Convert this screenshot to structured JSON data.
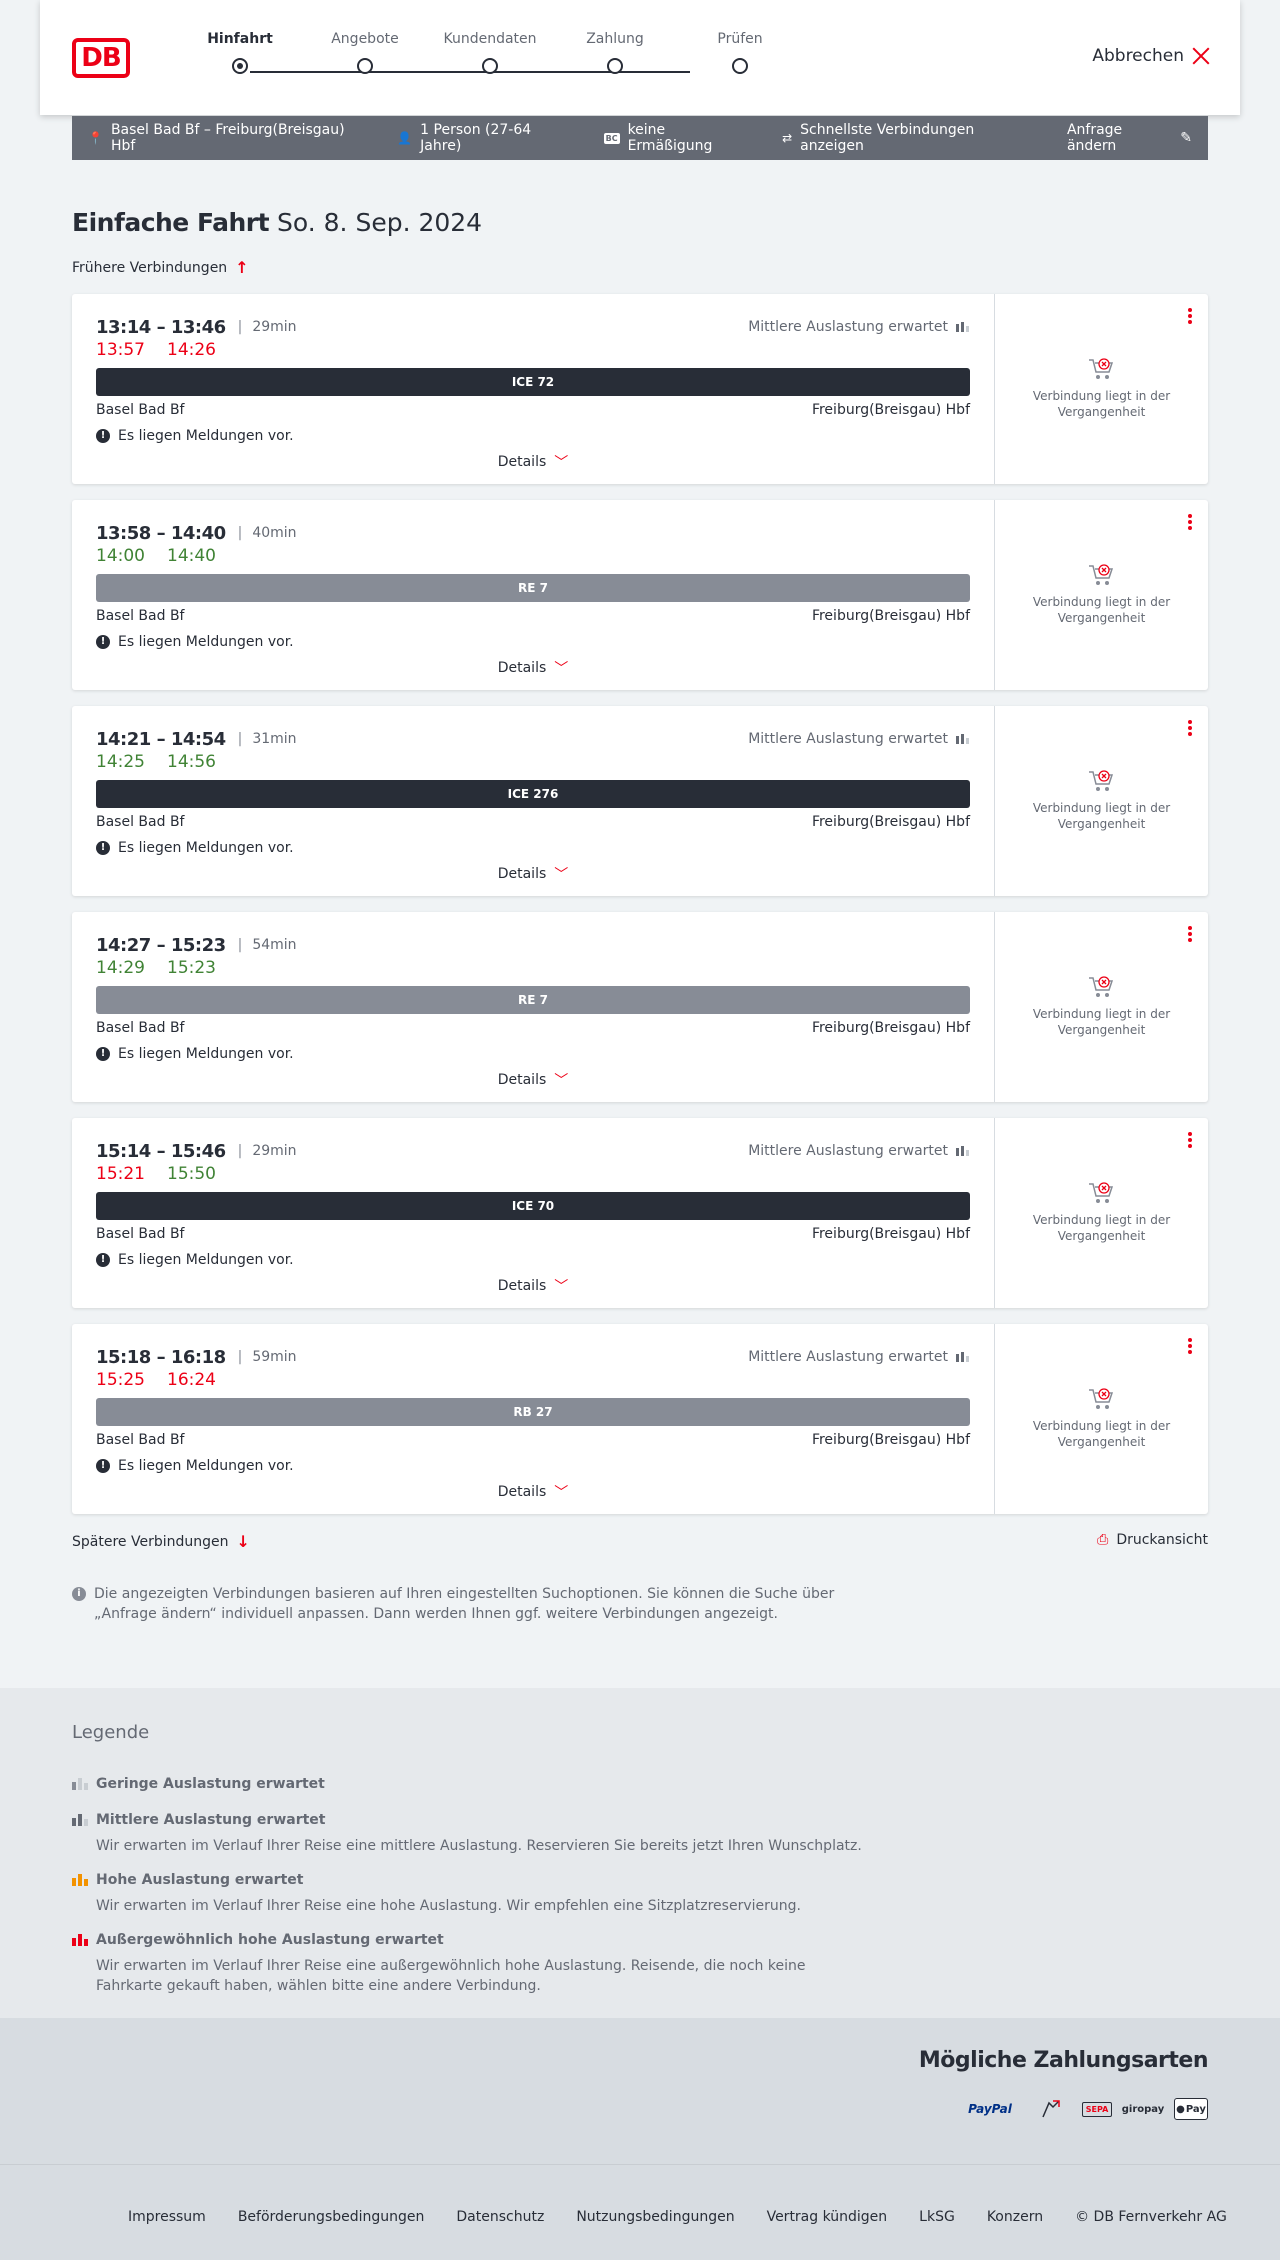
{
  "header": {
    "logo": "DB",
    "cancel_label": "Abbrechen",
    "steps": [
      {
        "label": "Hinfahrt"
      },
      {
        "label": "Angebote"
      },
      {
        "label": "Kundendaten"
      },
      {
        "label": "Zahlung"
      },
      {
        "label": "Prüfen"
      }
    ],
    "active_step": 0
  },
  "request": {
    "route": "Basel Bad Bf – Freiburg(Breisgau) Hbf",
    "passengers": "1 Person (27-64 Jahre)",
    "bc_badge": "BC",
    "discount": "keine Ermäßigung",
    "fastest": "Schnellste Verbindungen anzeigen",
    "edit_label": "Anfrage ändern"
  },
  "page": {
    "title": "Einfache Fahrt",
    "date": "So. 8. Sep. 2024",
    "earlier_label": "Frühere Verbindungen",
    "later_label": "Spätere Verbindungen",
    "print_label": "Druckansicht",
    "note": "Die angezeigten Verbindungen basieren auf Ihren eingestellten Suchoptionen. Sie können die Suche über „Anfrage ändern“ individuell anpassen. Dann werden Ihnen ggf. weitere Verbindungen angezeigt."
  },
  "connections": [
    {
      "plan": "13:14 – 13:46",
      "duration": "29min",
      "occupancy": "Mittlere Auslastung erwartet",
      "rt_dep": "13:57",
      "rt_arr": "14:26",
      "dep_status": "delay",
      "arr_status": "delay",
      "train": "ICE 72",
      "train_type": "ice",
      "from": "Basel Bad Bf",
      "to": "Freiburg(Breisgau) Hbf",
      "message": "Es liegen Meldungen vor.",
      "details": "Details",
      "status": "Verbindung liegt in der Vergangenheit"
    },
    {
      "plan": "13:58 – 14:40",
      "duration": "40min",
      "occupancy": "",
      "rt_dep": "14:00",
      "rt_arr": "14:40",
      "dep_status": "ok",
      "arr_status": "ok",
      "train": "RE 7",
      "train_type": "re",
      "from": "Basel Bad Bf",
      "to": "Freiburg(Breisgau) Hbf",
      "message": "Es liegen Meldungen vor.",
      "details": "Details",
      "status": "Verbindung liegt in der Vergangenheit"
    },
    {
      "plan": "14:21 – 14:54",
      "duration": "31min",
      "occupancy": "Mittlere Auslastung erwartet",
      "rt_dep": "14:25",
      "rt_arr": "14:56",
      "dep_status": "ok",
      "arr_status": "ok",
      "train": "ICE 276",
      "train_type": "ice",
      "from": "Basel Bad Bf",
      "to": "Freiburg(Breisgau) Hbf",
      "message": "Es liegen Meldungen vor.",
      "details": "Details",
      "status": "Verbindung liegt in der Vergangenheit"
    },
    {
      "plan": "14:27 – 15:23",
      "duration": "54min",
      "occupancy": "",
      "rt_dep": "14:29",
      "rt_arr": "15:23",
      "dep_status": "ok",
      "arr_status": "ok",
      "train": "RE 7",
      "train_type": "re",
      "from": "Basel Bad Bf",
      "to": "Freiburg(Breisgau) Hbf",
      "message": "Es liegen Meldungen vor.",
      "details": "Details",
      "status": "Verbindung liegt in der Vergangenheit"
    },
    {
      "plan": "15:14 – 15:46",
      "duration": "29min",
      "occupancy": "Mittlere Auslastung erwartet",
      "rt_dep": "15:21",
      "rt_arr": "15:50",
      "dep_status": "delay",
      "arr_status": "ok",
      "train": "ICE 70",
      "train_type": "ice",
      "from": "Basel Bad Bf",
      "to": "Freiburg(Breisgau) Hbf",
      "message": "Es liegen Meldungen vor.",
      "details": "Details",
      "status": "Verbindung liegt in der Vergangenheit"
    },
    {
      "plan": "15:18 – 16:18",
      "duration": "59min",
      "occupancy": "Mittlere Auslastung erwartet",
      "rt_dep": "15:25",
      "rt_arr": "16:24",
      "dep_status": "delay",
      "arr_status": "delay",
      "train": "RB 27",
      "train_type": "re",
      "from": "Basel Bad Bf",
      "to": "Freiburg(Breisgau) Hbf",
      "message": "Es liegen Meldungen vor.",
      "details": "Details",
      "status": "Verbindung liegt in der Vergangenheit"
    }
  ],
  "legend": {
    "title": "Legende",
    "items": [
      {
        "title": "Geringe Auslastung erwartet",
        "desc": "",
        "level": "low"
      },
      {
        "title": "Mittlere Auslastung erwartet",
        "desc": "Wir erwarten im Verlauf Ihrer Reise eine mittlere Auslastung. Reservieren Sie bereits jetzt Ihren Wunschplatz.",
        "level": "medium"
      },
      {
        "title": "Hohe Auslastung erwartet",
        "desc": "Wir erwarten im Verlauf Ihrer Reise eine hohe Auslastung. Wir empfehlen eine Sitzplatzreservierung.",
        "level": "high"
      },
      {
        "title": "Außergewöhnlich hohe Auslastung erwartet",
        "desc": "Wir erwarten im Verlauf Ihrer Reise eine außergewöhnlich hohe Auslastung. Reisende, die noch keine Fahrkarte gekauft haben, wählen bitte eine andere Verbindung.",
        "level": "very-high"
      }
    ]
  },
  "payment": {
    "title": "Mögliche Zahlungsarten",
    "methods": [
      "PayPal",
      "SEPA",
      "giropay",
      "Pay"
    ]
  },
  "footer": {
    "links": [
      "Impressum",
      "Beförderungsbedingungen",
      "Datenschutz",
      "Nutzungsbedingungen",
      "Vertrag kündigen",
      "LkSG",
      "Konzern",
      "© DB Fernverkehr AG"
    ]
  },
  "colors": {
    "brand_red": "#ec0016",
    "delay_red": "#ec0016",
    "ontime_green": "#408335",
    "ice_bar": "#282d37",
    "regional_bar": "#878c96",
    "occupancy_high": "#f39200"
  }
}
